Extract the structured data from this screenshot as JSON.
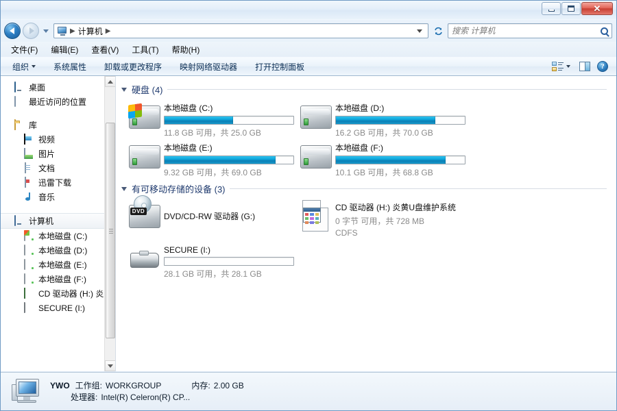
{
  "window": {
    "minimize_label": "最小化",
    "maximize_label": "最大化",
    "close_label": "关闭"
  },
  "address": {
    "back_label": "后退",
    "forward_label": "前进",
    "history_label": "最近的位置",
    "crumb_root": "计算机",
    "crumb_sep": "▶",
    "refresh_label": "↯",
    "dropdown_label": "▼"
  },
  "search": {
    "placeholder": "搜索 计算机",
    "value": ""
  },
  "menubar": {
    "items": [
      {
        "label": "文件(F)"
      },
      {
        "label": "编辑(E)"
      },
      {
        "label": "查看(V)"
      },
      {
        "label": "工具(T)"
      },
      {
        "label": "帮助(H)"
      }
    ]
  },
  "commandbar": {
    "organize": "组织",
    "items": [
      {
        "label": "系统属性"
      },
      {
        "label": "卸载或更改程序"
      },
      {
        "label": "映射网络驱动器"
      },
      {
        "label": "打开控制面板"
      }
    ],
    "view_label": "更改您的视图",
    "preview_label": "显示预览窗格",
    "help_label": "?"
  },
  "sidebar": {
    "groups": [
      {
        "items": [
          {
            "label": "桌面",
            "icon": "desktop-icon",
            "indent": 1
          },
          {
            "label": "最近访问的位置",
            "icon": "recent-places-icon",
            "indent": 1
          }
        ]
      },
      {
        "items": [
          {
            "label": "库",
            "icon": "library-folder-icon",
            "indent": 1
          },
          {
            "label": "视频",
            "icon": "video-icon",
            "indent": 2
          },
          {
            "label": "图片",
            "icon": "picture-icon",
            "indent": 2
          },
          {
            "label": "文档",
            "icon": "document-icon",
            "indent": 2
          },
          {
            "label": "迅雷下载",
            "icon": "download-icon",
            "indent": 2
          },
          {
            "label": "音乐",
            "icon": "music-icon",
            "indent": 2
          }
        ]
      },
      {
        "items": [
          {
            "label": "计算机",
            "icon": "computer-icon",
            "indent": 1,
            "selected": true
          },
          {
            "label": "本地磁盘 (C:)",
            "icon": "system-hdd-icon",
            "indent": 2
          },
          {
            "label": "本地磁盘 (D:)",
            "icon": "hdd-icon",
            "indent": 2
          },
          {
            "label": "本地磁盘 (E:)",
            "icon": "hdd-icon",
            "indent": 2
          },
          {
            "label": "本地磁盘 (F:)",
            "icon": "hdd-icon",
            "indent": 2
          },
          {
            "label": "CD 驱动器 (H:) 炎",
            "icon": "cd-drive-icon",
            "indent": 2
          },
          {
            "label": "SECURE (I:)",
            "icon": "usb-drive-icon",
            "indent": 2
          }
        ]
      }
    ]
  },
  "content": {
    "groups": [
      {
        "title": "硬盘 (4)",
        "name": "hard-disks-group",
        "tiles": [
          {
            "name": "本地磁盘 (C:)",
            "sub": "11.8 GB 可用，共 25.0 GB",
            "free_text": "11.8 GB 可用",
            "total_text": "共 25.0 GB",
            "used_percent": 53,
            "icon": "system-hdd-icon",
            "has_bar": true
          },
          {
            "name": "本地磁盘 (D:)",
            "sub": "16.2 GB 可用，共 70.0 GB",
            "free_text": "16.2 GB 可用",
            "total_text": "共 70.0 GB",
            "used_percent": 77,
            "icon": "hdd-icon",
            "has_bar": true
          },
          {
            "name": "本地磁盘 (E:)",
            "sub": "9.32 GB 可用，共 69.0 GB",
            "free_text": "9.32 GB 可用",
            "total_text": "共 69.0 GB",
            "used_percent": 86,
            "icon": "hdd-icon",
            "has_bar": true
          },
          {
            "name": "本地磁盘 (F:)",
            "sub": "10.1 GB 可用，共 68.8 GB",
            "free_text": "10.1 GB 可用",
            "total_text": "共 68.8 GB",
            "used_percent": 85,
            "icon": "hdd-icon",
            "has_bar": true
          }
        ]
      },
      {
        "title": "有可移动存储的设备 (3)",
        "name": "removable-devices-group",
        "tiles": [
          {
            "name": "DVD/CD-RW 驱动器 (G:)",
            "sub": "",
            "icon": "dvd-drive-icon",
            "has_bar": false,
            "label_badge": "DVD"
          },
          {
            "name": "CD 驱动器 (H:) 炎黄U盘维护系统",
            "sub": "0 字节 可用，共 728 MB",
            "sub2": "CDFS",
            "icon": "cd-media-icon",
            "has_bar": false
          },
          {
            "name": "SECURE (I:)",
            "sub": "28.1 GB 可用，共 28.1 GB",
            "used_percent": 0,
            "icon": "usb-drive-icon",
            "has_bar": true
          }
        ]
      }
    ]
  },
  "details": {
    "computer_name": "YWO",
    "workgroup_label": "工作组:",
    "workgroup_value": "WORKGROUP",
    "memory_label": "内存:",
    "memory_value": "2.00 GB",
    "processor_label": "处理器:",
    "processor_value": "Intel(R) Celeron(R) CP..."
  },
  "colors": {
    "accent": "#0fa7dc",
    "group_title": "#1f3a6e",
    "subtext": "#8a8a8a",
    "chrome": "#dfeaf6"
  }
}
